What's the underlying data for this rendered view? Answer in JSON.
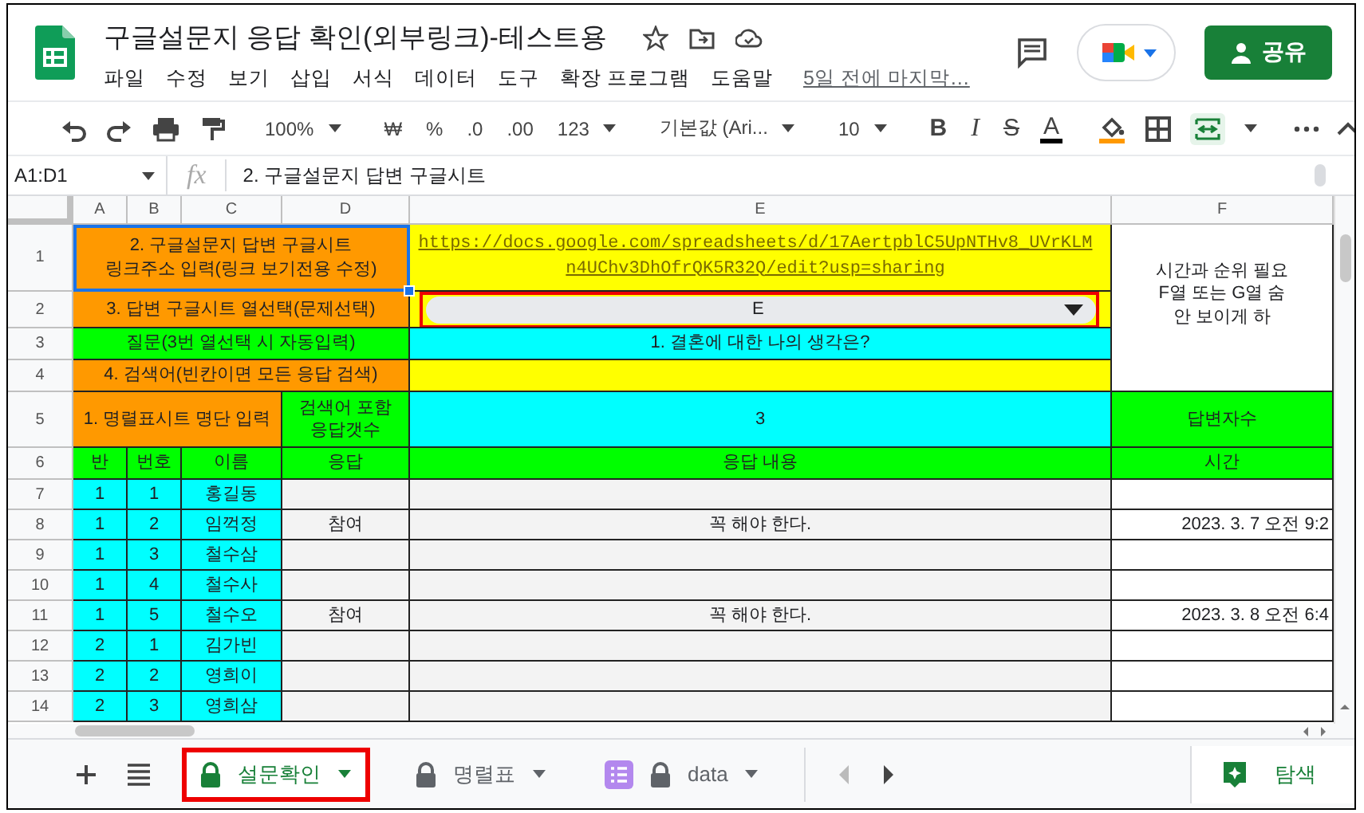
{
  "window": {
    "title": "구글설문지 응답 확인(외부링크)-테스트용",
    "last_edit": "5일 전에 마지막…"
  },
  "menu": [
    "파일",
    "수정",
    "보기",
    "삽입",
    "서식",
    "데이터",
    "도구",
    "확장 프로그램",
    "도움말"
  ],
  "share_button": {
    "label": "공유"
  },
  "toolbar": [
    {
      "kind": "dropdown",
      "label": "100%"
    },
    {
      "kind": "text",
      "label": "₩"
    },
    {
      "kind": "text",
      "label": "%"
    },
    {
      "kind": "text",
      "label": ".0"
    },
    {
      "kind": "text",
      "label": ".00"
    },
    {
      "kind": "dropdown",
      "label": "123"
    },
    {
      "kind": "dropdown",
      "label": "기본값 (Ari..."
    },
    {
      "kind": "dropdown",
      "label": "10"
    },
    {
      "kind": "bold",
      "label": "B"
    },
    {
      "kind": "italic",
      "label": "I"
    },
    {
      "kind": "strike",
      "label": "S"
    },
    {
      "kind": "textcolor",
      "label": "A"
    }
  ],
  "formula_bar": {
    "name_box": "A1:D1",
    "fx": "fx",
    "content": "2. 구글설문지 답변 구글시트"
  },
  "sheet": {
    "columns": [
      "A",
      "B",
      "C",
      "D",
      "E",
      "F"
    ],
    "rows": [
      {
        "number": "1",
        "cells": [
          {
            "kind": "text",
            "color": "#ff9900",
            "selected": true,
            "text": "2. 구글설문지 답변 구글시트\n링크주소 입력(링크 보기전용 수정)"
          },
          {
            "kind": "merged"
          },
          {
            "kind": "merged"
          },
          {
            "kind": "merged"
          },
          {
            "kind": "link",
            "color": "#ffff00",
            "selected": false,
            "text": "https://docs.google.com/spreadsheets/d/17AertpblC5UpNTHv8_UVrKLMn4UChv3DhOfrQK5R32Q/edit?usp=sharing"
          },
          {
            "kind": "note",
            "color": "#ffffff",
            "selected": false,
            "text": "시간과 순위 필요\nF열 또는 G열 숨\n안 보이게 하"
          }
        ]
      },
      {
        "number": "2",
        "cells": [
          {
            "kind": "text",
            "color": "#ff9900",
            "selected": false,
            "text": "3. 답변 구글시트 열선택(문제선택)"
          },
          {
            "kind": "merged"
          },
          {
            "kind": "merged"
          },
          {
            "kind": "merged"
          },
          {
            "kind": "dropdown",
            "color": "#ffff00",
            "selected": false,
            "highlighted": true,
            "text": "E"
          },
          {
            "kind": "merged"
          }
        ]
      },
      {
        "number": "3",
        "cells": [
          {
            "kind": "text",
            "color": "#00ff00",
            "selected": false,
            "text": "질문(3번 열선택 시 자동입력)"
          },
          {
            "kind": "merged"
          },
          {
            "kind": "merged"
          },
          {
            "kind": "merged"
          },
          {
            "kind": "text",
            "color": "#00ffff",
            "selected": false,
            "text": "1. 결혼에 대한 나의 생각은?"
          },
          {
            "kind": "merged"
          }
        ]
      },
      {
        "number": "4",
        "cells": [
          {
            "kind": "text",
            "color": "#ff9900",
            "selected": false,
            "text": "4. 검색어(빈칸이면 모든 응답 검색)"
          },
          {
            "kind": "merged"
          },
          {
            "kind": "merged"
          },
          {
            "kind": "merged"
          },
          {
            "kind": "text",
            "color": "#ffff00",
            "selected": false
          },
          {
            "kind": "merged"
          }
        ]
      },
      {
        "number": "5",
        "cells": [
          {
            "kind": "text",
            "color": "#ff9900",
            "selected": false,
            "text": "1. 명렬표시트 명단 입력"
          },
          {
            "kind": "merged"
          },
          {
            "kind": "merged"
          },
          {
            "kind": "text",
            "color": "#00ff00",
            "selected": false,
            "text": "검색어 포함\n응답갯수"
          },
          {
            "kind": "text",
            "color": "#00ffff",
            "selected": false,
            "text": "3"
          },
          {
            "kind": "text",
            "color": "#00ff00",
            "selected": false,
            "text": "답변자수"
          }
        ]
      },
      {
        "number": "6",
        "cells": [
          {
            "kind": "text",
            "color": "#00ff00",
            "selected": false,
            "text": "반"
          },
          {
            "kind": "text",
            "color": "#00ff00",
            "selected": false,
            "text": "번호"
          },
          {
            "kind": "text",
            "color": "#00ff00",
            "selected": false,
            "text": "이름"
          },
          {
            "kind": "text",
            "color": "#00ff00",
            "selected": false,
            "text": "응답"
          },
          {
            "kind": "text",
            "color": "#00ff00",
            "selected": false,
            "text": "응답 내용"
          },
          {
            "kind": "text",
            "color": "#00ff00",
            "selected": false,
            "text": "시간"
          }
        ]
      },
      {
        "number": "7",
        "cells": [
          {
            "kind": "text",
            "color": "#00ffff",
            "selected": false,
            "text": "1"
          },
          {
            "kind": "text",
            "color": "#00ffff",
            "selected": false,
            "text": "1"
          },
          {
            "kind": "text",
            "color": "#00ffff",
            "selected": false,
            "text": "홍길동"
          },
          {
            "kind": "text",
            "color": "#f3f3f3",
            "selected": false
          },
          {
            "kind": "text",
            "color": "#f3f3f3",
            "selected": false
          },
          {
            "kind": "time",
            "color": "#ffffff",
            "selected": false
          }
        ]
      },
      {
        "number": "8",
        "cells": [
          {
            "kind": "text",
            "color": "#00ffff",
            "selected": false,
            "text": "1"
          },
          {
            "kind": "text",
            "color": "#00ffff",
            "selected": false,
            "text": "2"
          },
          {
            "kind": "text",
            "color": "#00ffff",
            "selected": false,
            "text": "임꺽정"
          },
          {
            "kind": "text",
            "color": "#f3f3f3",
            "selected": false,
            "text": "참여"
          },
          {
            "kind": "text",
            "color": "#f3f3f3",
            "selected": false,
            "text": "꼭 해야 한다."
          },
          {
            "kind": "time",
            "color": "#ffffff",
            "selected": false,
            "text": "2023. 3. 7 오전 9:2"
          }
        ]
      },
      {
        "number": "9",
        "cells": [
          {
            "kind": "text",
            "color": "#00ffff",
            "selected": false,
            "text": "1"
          },
          {
            "kind": "text",
            "color": "#00ffff",
            "selected": false,
            "text": "3"
          },
          {
            "kind": "text",
            "color": "#00ffff",
            "selected": false,
            "text": "철수삼"
          },
          {
            "kind": "text",
            "color": "#f3f3f3",
            "selected": false
          },
          {
            "kind": "text",
            "color": "#f3f3f3",
            "selected": false
          },
          {
            "kind": "time",
            "color": "#ffffff",
            "selected": false
          }
        ]
      },
      {
        "number": "10",
        "cells": [
          {
            "kind": "text",
            "color": "#00ffff",
            "selected": false,
            "text": "1"
          },
          {
            "kind": "text",
            "color": "#00ffff",
            "selected": false,
            "text": "4"
          },
          {
            "kind": "text",
            "color": "#00ffff",
            "selected": false,
            "text": "철수사"
          },
          {
            "kind": "text",
            "color": "#f3f3f3",
            "selected": false
          },
          {
            "kind": "text",
            "color": "#f3f3f3",
            "selected": false
          },
          {
            "kind": "time",
            "color": "#ffffff",
            "selected": false
          }
        ]
      },
      {
        "number": "11",
        "cells": [
          {
            "kind": "text",
            "color": "#00ffff",
            "selected": false,
            "text": "1"
          },
          {
            "kind": "text",
            "color": "#00ffff",
            "selected": false,
            "text": "5"
          },
          {
            "kind": "text",
            "color": "#00ffff",
            "selected": false,
            "text": "철수오"
          },
          {
            "kind": "text",
            "color": "#f3f3f3",
            "selected": false,
            "text": "참여"
          },
          {
            "kind": "text",
            "color": "#f3f3f3",
            "selected": false,
            "text": "꼭 해야 한다."
          },
          {
            "kind": "time",
            "color": "#ffffff",
            "selected": false,
            "text": "2023. 3. 8 오전 6:4"
          }
        ]
      },
      {
        "number": "12",
        "cells": [
          {
            "kind": "text",
            "color": "#00ffff",
            "selected": false,
            "text": "2"
          },
          {
            "kind": "text",
            "color": "#00ffff",
            "selected": false,
            "text": "1"
          },
          {
            "kind": "text",
            "color": "#00ffff",
            "selected": false,
            "text": "김가빈"
          },
          {
            "kind": "text",
            "color": "#f3f3f3",
            "selected": false
          },
          {
            "kind": "text",
            "color": "#f3f3f3",
            "selected": false
          },
          {
            "kind": "time",
            "color": "#ffffff",
            "selected": false
          }
        ]
      },
      {
        "number": "13",
        "cells": [
          {
            "kind": "text",
            "color": "#00ffff",
            "selected": false,
            "text": "2"
          },
          {
            "kind": "text",
            "color": "#00ffff",
            "selected": false,
            "text": "2"
          },
          {
            "kind": "text",
            "color": "#00ffff",
            "selected": false,
            "text": "영희이"
          },
          {
            "kind": "text",
            "color": "#f3f3f3",
            "selected": false
          },
          {
            "kind": "text",
            "color": "#f3f3f3",
            "selected": false
          },
          {
            "kind": "time",
            "color": "#ffffff",
            "selected": false
          }
        ]
      },
      {
        "number": "14",
        "cells": [
          {
            "kind": "text",
            "color": "#00ffff",
            "selected": false,
            "text": "2"
          },
          {
            "kind": "text",
            "color": "#00ffff",
            "selected": false,
            "text": "3"
          },
          {
            "kind": "text",
            "color": "#00ffff",
            "selected": false,
            "text": "영희삼"
          },
          {
            "kind": "text",
            "color": "#f3f3f3",
            "selected": false
          },
          {
            "kind": "text",
            "color": "#f3f3f3",
            "selected": false
          },
          {
            "kind": "time",
            "color": "#ffffff",
            "selected": false
          }
        ]
      }
    ]
  },
  "sheet_tabs": [
    {
      "label": "설문확인",
      "selected": true,
      "highlighted": true,
      "locked": true,
      "list_icon": false
    },
    {
      "label": "명렬표",
      "selected": false,
      "highlighted": false,
      "locked": true,
      "list_icon": false
    },
    {
      "label": "data",
      "selected": false,
      "highlighted": false,
      "locked": true,
      "list_icon": true
    }
  ],
  "explore_button": {
    "label": "탐색"
  }
}
